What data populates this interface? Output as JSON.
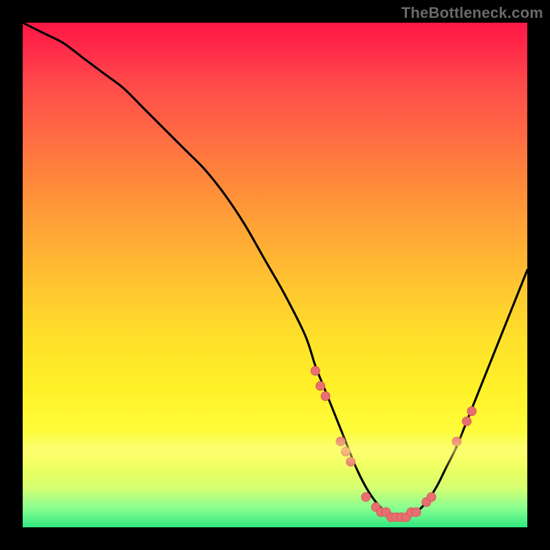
{
  "watermark": "TheBottleneck.com",
  "colors": {
    "curve_stroke": "#000000",
    "marker_fill": "#e76f6f",
    "marker_stroke": "#d85a5a",
    "background": "#000000"
  },
  "chart_data": {
    "type": "line",
    "title": "",
    "xlabel": "",
    "ylabel": "",
    "xlim": [
      0,
      100
    ],
    "ylim": [
      0,
      100
    ],
    "grid": false,
    "legend": false,
    "series": [
      {
        "name": "curve",
        "x": [
          0,
          4,
          8,
          12,
          16,
          20,
          24,
          28,
          32,
          36,
          40,
          44,
          48,
          52,
          56,
          58,
          60,
          62,
          64,
          66,
          68,
          70,
          72,
          74,
          76,
          78,
          80,
          82,
          84,
          86,
          88,
          90,
          92,
          94,
          96,
          98,
          100
        ],
        "y": [
          100,
          98,
          96,
          93,
          90,
          87,
          83,
          79,
          75,
          71,
          66,
          60,
          53,
          46,
          38,
          32,
          27,
          22,
          17,
          12,
          8,
          5,
          3,
          2,
          2,
          3,
          5,
          8,
          12,
          16,
          21,
          26,
          31,
          36,
          41,
          46,
          51
        ]
      }
    ],
    "markers": [
      {
        "x": 58,
        "y": 31
      },
      {
        "x": 59,
        "y": 28
      },
      {
        "x": 60,
        "y": 26
      },
      {
        "x": 63,
        "y": 17
      },
      {
        "x": 64,
        "y": 15
      },
      {
        "x": 65,
        "y": 13
      },
      {
        "x": 68,
        "y": 6
      },
      {
        "x": 70,
        "y": 4
      },
      {
        "x": 71,
        "y": 3
      },
      {
        "x": 72,
        "y": 3
      },
      {
        "x": 73,
        "y": 2
      },
      {
        "x": 74,
        "y": 2
      },
      {
        "x": 75,
        "y": 2
      },
      {
        "x": 76,
        "y": 2
      },
      {
        "x": 77,
        "y": 3
      },
      {
        "x": 78,
        "y": 3
      },
      {
        "x": 80,
        "y": 5
      },
      {
        "x": 81,
        "y": 6
      },
      {
        "x": 86,
        "y": 17
      },
      {
        "x": 88,
        "y": 21
      },
      {
        "x": 89,
        "y": 23
      }
    ]
  }
}
